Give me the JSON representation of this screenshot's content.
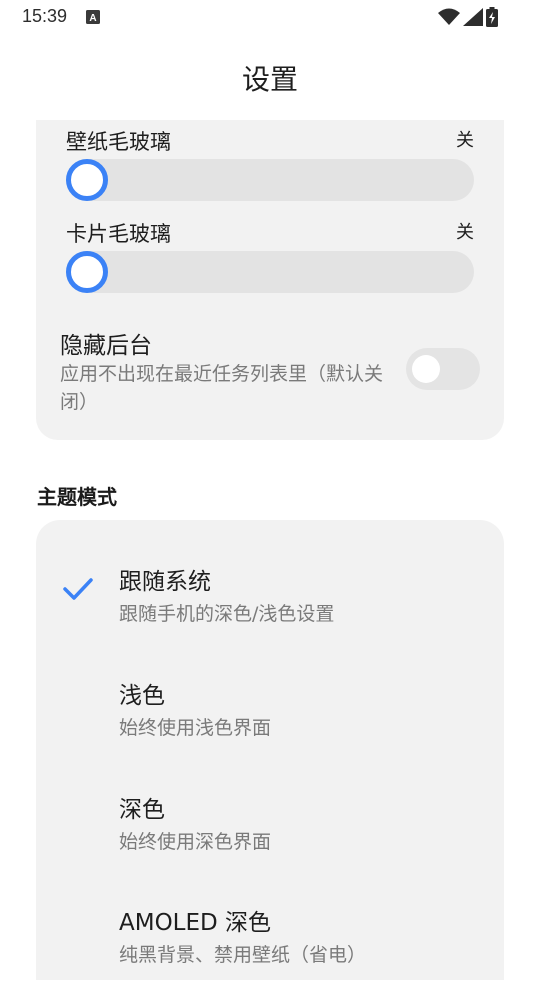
{
  "status_bar": {
    "time": "15:39",
    "notification_icon": "a-letter-icon",
    "wifi_icon": "wifi-icon",
    "signal_icon": "signal-icon",
    "battery_icon": "battery-charging-icon"
  },
  "header": {
    "title": "设置"
  },
  "settings": {
    "wallpaper_blur": {
      "label": "壁纸毛玻璃",
      "value_text": "关",
      "level": 0
    },
    "card_blur": {
      "label": "卡片毛玻璃",
      "value_text": "关",
      "level": 0
    },
    "hide_background": {
      "label": "隐藏后台",
      "description": "应用不出现在最近任务列表里（默认关闭）",
      "enabled": false
    }
  },
  "theme": {
    "heading": "主题模式",
    "options": [
      {
        "title": "跟随系统",
        "description": "跟随手机的深色/浅色设置",
        "selected": true
      },
      {
        "title": "浅色",
        "description": "始终使用浅色界面",
        "selected": false
      },
      {
        "title": "深色",
        "description": "始终使用深色界面",
        "selected": false
      },
      {
        "title": "AMOLED 深色",
        "description": "纯黑背景、禁用壁纸（省电）",
        "selected": false
      }
    ]
  },
  "colors": {
    "accent": "#3b82f6",
    "card_background": "#f2f2f2",
    "secondary_text": "#7a7a7a"
  }
}
